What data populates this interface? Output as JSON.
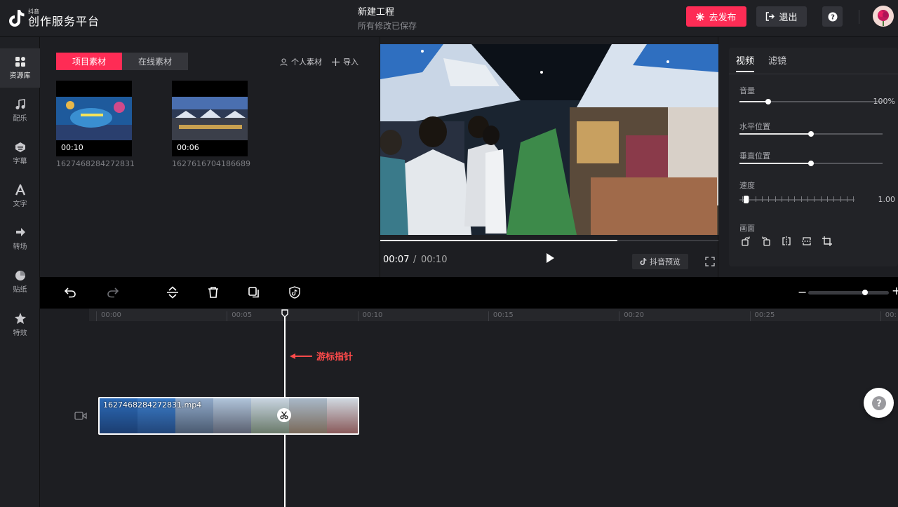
{
  "app": {
    "brand_small": "抖音",
    "brand_name": "创作服务平台"
  },
  "header": {
    "project_title": "新建工程",
    "save_status": "所有修改已保存",
    "publish_label": "去发布",
    "exit_label": "退出"
  },
  "sidebar": {
    "items": [
      {
        "label": "资源库",
        "icon": "grid-icon",
        "active": true
      },
      {
        "label": "配乐",
        "icon": "music-note-icon"
      },
      {
        "label": "字幕",
        "icon": "subtitle-icon"
      },
      {
        "label": "文字",
        "icon": "text-icon"
      },
      {
        "label": "转场",
        "icon": "transition-icon"
      },
      {
        "label": "贴纸",
        "icon": "sticker-icon"
      },
      {
        "label": "特效",
        "icon": "effects-star-icon"
      }
    ]
  },
  "media": {
    "tabs": [
      "项目素材",
      "在线素材"
    ],
    "active_tab": 0,
    "personal_label": "个人素材",
    "import_label": "导入",
    "items": [
      {
        "duration": "00:10",
        "name": "1627468284272831"
      },
      {
        "duration": "00:06",
        "name": "1627616704186689"
      }
    ]
  },
  "preview": {
    "current_time": "00:07",
    "separator": "/",
    "total_time": "00:10",
    "progress": 0.7,
    "preview_label": "抖音预览"
  },
  "properties": {
    "tabs": [
      "视频",
      "滤镜"
    ],
    "active_tab": 0,
    "volume_label": "音量",
    "volume_value": "100%",
    "volume_level": 0.2,
    "hpos_label": "水平位置",
    "hpos_level": 0.5,
    "vpos_label": "垂直位置",
    "vpos_level": 0.5,
    "speed_label": "速度",
    "speed_value": "1.00",
    "frame_label": "画面"
  },
  "toolbar": {
    "zoom_minus": "−",
    "zoom_plus": "+",
    "zoom_level": 0.7
  },
  "timeline": {
    "ruler_labels": [
      "00:00",
      "00:05",
      "00:10",
      "00:15",
      "00:20",
      "00:25",
      "00:"
    ],
    "annotation": "游标指针",
    "clip_name": "1627468284272831.mp4"
  },
  "colors": {
    "accent": "#fe2c55",
    "annotation": "#ff4a4a"
  }
}
